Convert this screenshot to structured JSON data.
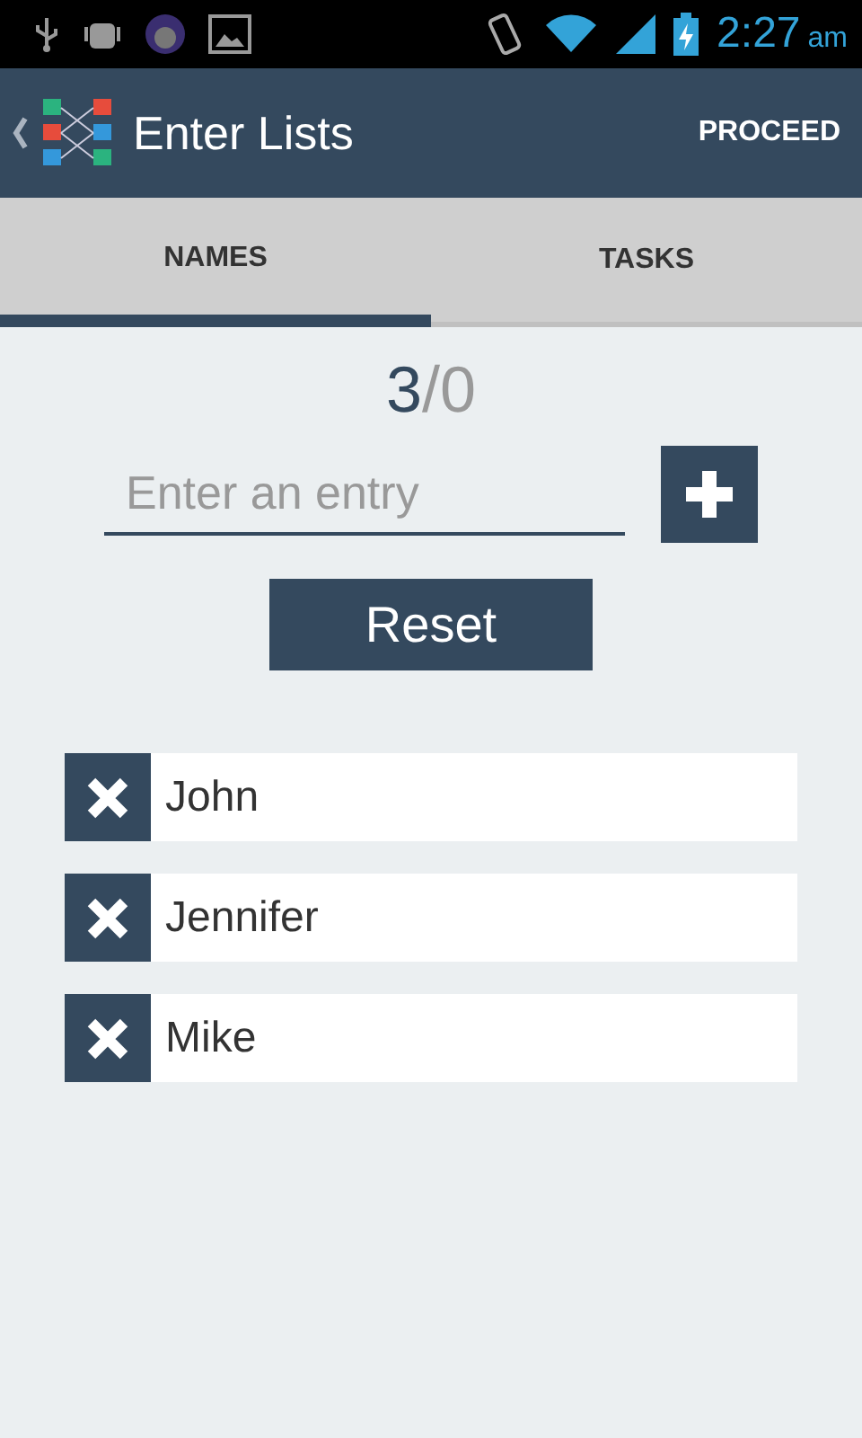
{
  "status_bar": {
    "time": "2:27",
    "meridiem": "am"
  },
  "app_bar": {
    "title": "Enter Lists",
    "action": "PROCEED"
  },
  "tabs": [
    {
      "label": "NAMES",
      "selected": true
    },
    {
      "label": "TASKS",
      "selected": false
    }
  ],
  "counter": {
    "done": "3",
    "rest": "/0"
  },
  "entry_field": {
    "placeholder": "Enter an entry"
  },
  "reset_button": "Reset",
  "entries": [
    {
      "name": "John"
    },
    {
      "name": "Jennifer"
    },
    {
      "name": "Mike"
    }
  ]
}
